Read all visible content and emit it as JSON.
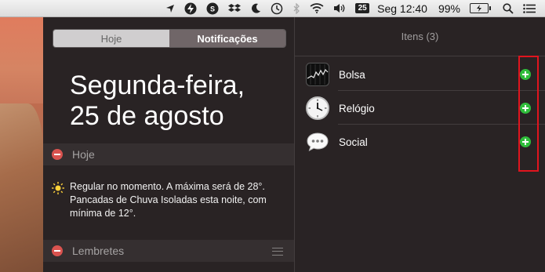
{
  "menubar": {
    "calendar_day": "25",
    "datetime": "Seg 12:40",
    "battery_percent": "99%"
  },
  "tabs": {
    "today": "Hoje",
    "notifications": "Notificações"
  },
  "date": {
    "weekday": "Segunda-feira,",
    "day_month": "25 de agosto"
  },
  "sections": {
    "today_header": "Hoje",
    "reminders_header": "Lembretes"
  },
  "weather": {
    "text_line1": "Regular no momento. A máxima será de 28°.",
    "text_line2": "Pancadas de Chuva Isoladas esta noite, com",
    "text_line3": "mínima de 12°."
  },
  "items": {
    "title": "Itens (3)",
    "list": [
      {
        "label": "Bolsa",
        "icon": "stocks-icon"
      },
      {
        "label": "Relógio",
        "icon": "clock-icon"
      },
      {
        "label": "Social",
        "icon": "social-icon"
      }
    ]
  },
  "colors": {
    "add_button": "#2fbd3b",
    "remove_button": "#d9534f",
    "highlight": "#e0141e"
  }
}
